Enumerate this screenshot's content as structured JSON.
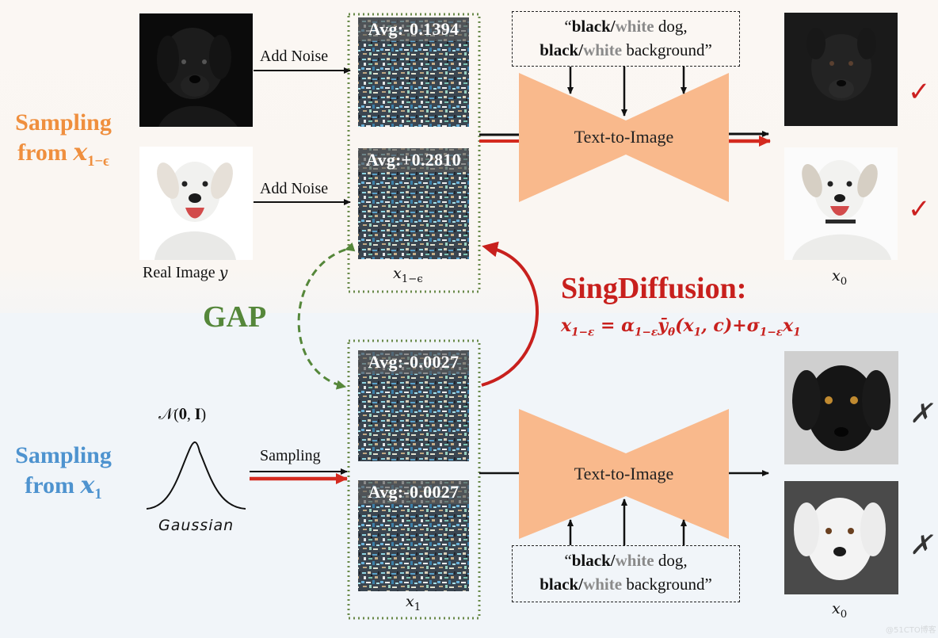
{
  "colors": {
    "orange_text": "#ef8f3e",
    "blue_text": "#4e93cf",
    "gap_green": "#55873a",
    "singdiffusion_red": "#c8201d",
    "model_fill": "#f9b98c",
    "arrow_red": "#d42a1f",
    "check_red": "#cc2020"
  },
  "top_section": {
    "title_line1": "Sampling",
    "title_line2_prefix": "from ",
    "title_math": "x",
    "title_sub": "1−ϵ",
    "real_images": [
      {
        "name": "black-dog",
        "arrow_label": "Add Noise"
      },
      {
        "name": "white-dog",
        "arrow_label": "Add Noise"
      }
    ],
    "real_image_caption": "Real Image ",
    "real_image_var": "y",
    "noise_avgs": [
      "Avg:-0.1394",
      "Avg:+0.2810"
    ],
    "noise_caption_var": "x",
    "noise_caption_sub": "1−ϵ",
    "prompt": {
      "open_quote": "“",
      "black1": "black",
      "slash1": "/",
      "white1": "white",
      "rest1": " dog,",
      "black2": "black",
      "slash2": "/",
      "white2": "white",
      "rest2": " background”"
    },
    "model_label": "Text-to-Image",
    "output_caption_var": "x",
    "output_caption_sub": "0",
    "results": [
      "✓",
      "✓"
    ]
  },
  "gap_label": "GAP",
  "singdiffusion": {
    "title": "SingDiffusion:",
    "eq": {
      "lhs": "x",
      "lhs_sub": "1−ε",
      "eq": " = ",
      "alpha": "α",
      "alpha_sub": "1−ε",
      "ybar": "ȳ",
      "ybar_sub": "θ",
      "args_open": "(x",
      "args_sub": "1",
      "args_rest": ", c)",
      "plus": "+",
      "sigma": "σ",
      "sigma_sub": "1−ε",
      "x": "x",
      "x_sub": "1"
    }
  },
  "bottom_section": {
    "title_line1": "Sampling",
    "title_line2_prefix": "from ",
    "title_math": "x",
    "title_sub": "1",
    "distribution": "𝒩(𝟎, 𝐈)",
    "distribution_caption": "Gaussian",
    "arrow_label": "Sampling",
    "noise_avgs": [
      "Avg:-0.0027",
      "Avg:-0.0027"
    ],
    "noise_caption_var": "x",
    "noise_caption_sub": "1",
    "model_label": "Text-to-Image",
    "prompt": {
      "open_quote": "“",
      "black1": "black",
      "slash1": "/",
      "white1": "white",
      "rest1": " dog,",
      "black2": "black",
      "slash2": "/",
      "white2": "white",
      "rest2": " background”"
    },
    "output_caption_var": "x",
    "output_caption_sub": "0",
    "results": [
      "✗",
      "✗"
    ]
  },
  "watermark": "@51CTO博客"
}
